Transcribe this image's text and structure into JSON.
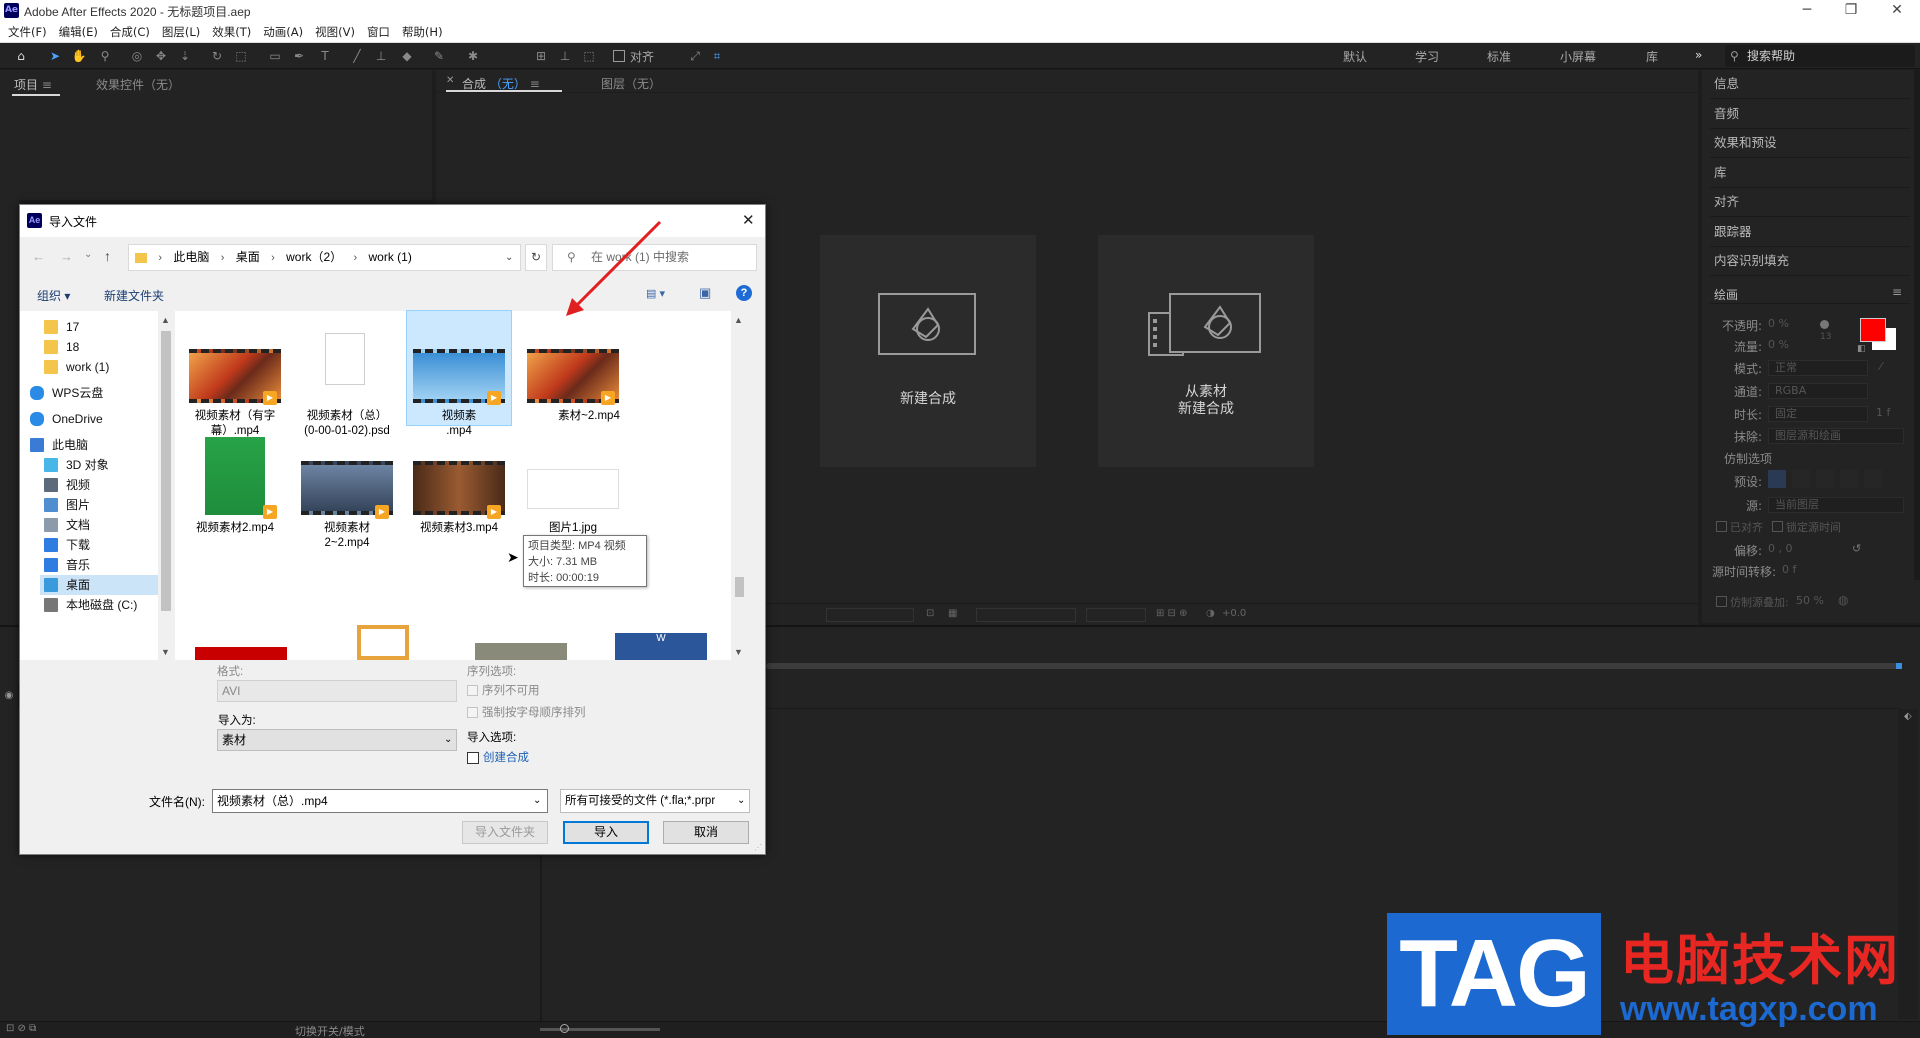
{
  "window": {
    "title": "Adobe After Effects 2020 - 无标题项目.aep",
    "app_logo": "Ae"
  },
  "menu": [
    "文件(F)",
    "编辑(E)",
    "合成(C)",
    "图层(L)",
    "效果(T)",
    "动画(A)",
    "视图(V)",
    "窗口",
    "帮助(H)"
  ],
  "toolbar": {
    "snap_label": "对齐",
    "workspaces": [
      "默认",
      "学习",
      "标准",
      "小屏幕",
      "库"
    ],
    "search_help": "搜索帮助"
  },
  "left_panel": {
    "tab_project": "项目",
    "tab_effects": "效果控件（无）"
  },
  "comp_panel": {
    "tab_comp_prefix": "合成",
    "tab_comp_value": "（无）",
    "tab_layer": "图层（无）",
    "card_new_comp": "新建合成",
    "card_from_footage_1": "从素材",
    "card_from_footage_2": "新建合成"
  },
  "right_panel": {
    "items": [
      "信息",
      "音频",
      "效果和预设",
      "库",
      "对齐",
      "跟踪器",
      "内容识别填充"
    ],
    "paint_title": "绘画",
    "paint": {
      "opacity_label": "不透明:",
      "opacity_value": "0 %",
      "flow_label": "流量:",
      "flow_value": "0 %",
      "mode_label": "模式:",
      "mode_value": "正常",
      "channel_label": "通道:",
      "channel_value": "RGBA",
      "duration_label": "时长:",
      "duration_value": "固定",
      "erase_label": "抹除:",
      "erase_value": "图层源和绘画",
      "clone_options": "仿制选项",
      "preset_label": "预设:",
      "source_label": "源:",
      "source_value": "当前图层",
      "aligned": "已对齐",
      "lock_source_time": "锁定源时间",
      "offset_label": "偏移:",
      "offset_value": "0 ,   0",
      "source_time_shift_label": "源时间转移:",
      "source_time_shift_value": "0 f",
      "clone_overlay": "仿制源叠加:",
      "clone_overlay_value": "50 %",
      "brush_size_value": "13"
    },
    "colors": {
      "foreground": "#ff0000",
      "background": "#ffffff"
    }
  },
  "timeline": {
    "toggle_label": "切换开关/模式"
  },
  "viewer_bar": {
    "exposure": "+0.0"
  },
  "dialog": {
    "title": "导入文件",
    "breadcrumb": [
      "此电脑",
      "桌面",
      "work（2）",
      "work (1)"
    ],
    "search_placeholder": "在 work (1) 中搜索",
    "organize": "组织 ▾",
    "new_folder": "新建文件夹",
    "nav_items": [
      {
        "label": "17",
        "icon": "folder-icon"
      },
      {
        "label": "18",
        "icon": "folder-icon"
      },
      {
        "label": "work (1)",
        "icon": "folder-icon"
      },
      {
        "label": "WPS云盘",
        "icon": "cloud-icon"
      },
      {
        "label": "OneDrive",
        "icon": "cloud-icon"
      },
      {
        "label": "此电脑",
        "icon": "computer-icon"
      },
      {
        "label": "3D 对象",
        "icon": "cube-icon"
      },
      {
        "label": "视频",
        "icon": "video-icon"
      },
      {
        "label": "图片",
        "icon": "picture-icon"
      },
      {
        "label": "文档",
        "icon": "document-icon"
      },
      {
        "label": "下载",
        "icon": "download-icon"
      },
      {
        "label": "音乐",
        "icon": "music-icon"
      },
      {
        "label": "桌面",
        "icon": "desktop-icon"
      },
      {
        "label": "本地磁盘 (C:)",
        "icon": "drive-icon"
      }
    ],
    "files": [
      {
        "name": "视频素材（有字幕）.mp4",
        "line1": "视频素材（有字",
        "line2": "幕）.mp4",
        "thumb": "autumn"
      },
      {
        "name": "视频素材（总）(0-00-01-02).psd",
        "line1": "视频素材（总）",
        "line2": "(0-00-01-02).psd",
        "thumb": "blank"
      },
      {
        "name": "视频素材（总）.mp4",
        "line1": "视频素",
        "line2": ".mp4",
        "thumb": "walker"
      },
      {
        "name": "视频素材~2.mp4",
        "line1": "素材~2.mp4",
        "line2": "",
        "thumb": "autumn"
      },
      {
        "name": "视频素材2.mp4",
        "line1": "视频素材2.mp4",
        "line2": "",
        "thumb": "greenscreen"
      },
      {
        "name": "视频素材2~2.mp4",
        "line1": "视频素材",
        "line2": "2~2.mp4",
        "thumb": "city"
      },
      {
        "name": "视频素材3.mp4",
        "line1": "视频素材3.mp4",
        "line2": "",
        "thumb": "glasses"
      },
      {
        "name": "图片1.jpg",
        "line1": "图片1.jpg",
        "line2": "",
        "thumb": "chart"
      }
    ],
    "tooltip": {
      "type": "项目类型: MP4 视频",
      "size": "大小: 7.31 MB",
      "duration": "时长: 00:00:19"
    },
    "format_label": "格式:",
    "format_value": "AVI",
    "import_as_label": "导入为:",
    "import_as_value": "素材",
    "sequence_options": "序列选项:",
    "sequence_unavailable": "序列不可用",
    "force_alpha": "强制按字母顺序排列",
    "import_options": "导入选项:",
    "create_comp": "创建合成",
    "filename_label": "文件名(N):",
    "filename_value": "视频素材（总）.mp4",
    "filetype_value": "所有可接受的文件 (*.fla;*.prpr",
    "btn_import_folder": "导入文件夹",
    "btn_import": "导入",
    "btn_cancel": "取消"
  },
  "watermark": {
    "tag": "TAG",
    "title": "电脑技术网",
    "url": "www.tagxp.com"
  }
}
